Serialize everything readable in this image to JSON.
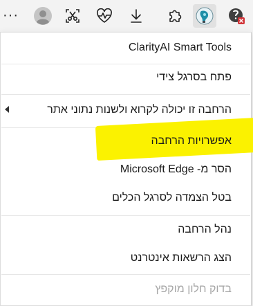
{
  "toolbar": {
    "more_label": "···",
    "buttons": [
      {
        "icon": "profile-avatar-icon"
      },
      {
        "icon": "screenshot-scissors-icon"
      },
      {
        "icon": "heartbeat-icon"
      },
      {
        "icon": "downloads-icon"
      },
      {
        "icon": "extensions-puzzle-icon"
      },
      {
        "icon": "clarityai-extension-icon"
      },
      {
        "icon": "blocked-extension-icon"
      }
    ]
  },
  "menu": {
    "title": "ClarityAI Smart Tools",
    "open_sidebar": "פתח בסרגל צידי",
    "site_access": "הרחבה זו יכולה לקרוא ולשנות נתוני אתר",
    "extension_options": "אפשרויות הרחבה",
    "remove_from": "הסר מ- Microsoft Edge",
    "unpin_toolbar": "בטל הצמדה לסרגל הכלים",
    "manage_extension": "נהל הרחבה",
    "view_web_permissions": "הצג הרשאות אינטרנט",
    "inspect_popup": "בדוק חלון מוקפץ"
  },
  "colors": {
    "highlight": "#fbf200",
    "menu_bg": "#ffffff",
    "toolbar_bg": "#f3f3f3",
    "disabled_text": "#a6a6a6",
    "blocked_badge": "#d13438"
  }
}
